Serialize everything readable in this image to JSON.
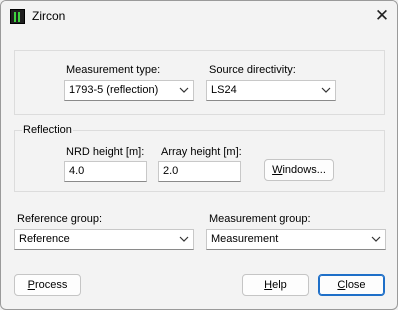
{
  "window": {
    "title": "Zircon",
    "close_icon": "close-icon"
  },
  "measurement_type": {
    "label": "Measurement type:",
    "value": "1793-5 (reflection)"
  },
  "source_directivity": {
    "label": "Source directivity:",
    "value": "LS24"
  },
  "reflection": {
    "group_label": "Reflection",
    "nrd_height_label": "NRD height [m]:",
    "nrd_height_value": "4.0",
    "array_height_label": "Array height [m]:",
    "array_height_value": "2.0",
    "windows_button": {
      "u": "W",
      "rest": "indows..."
    }
  },
  "reference_group": {
    "label": "Reference group:",
    "value": "Reference"
  },
  "measurement_group": {
    "label": "Measurement group:",
    "value": "Measurement"
  },
  "buttons": {
    "process": {
      "u": "P",
      "rest": "rocess"
    },
    "help": {
      "u": "H",
      "rest": "elp"
    },
    "close": {
      "u": "C",
      "rest": "lose"
    }
  }
}
